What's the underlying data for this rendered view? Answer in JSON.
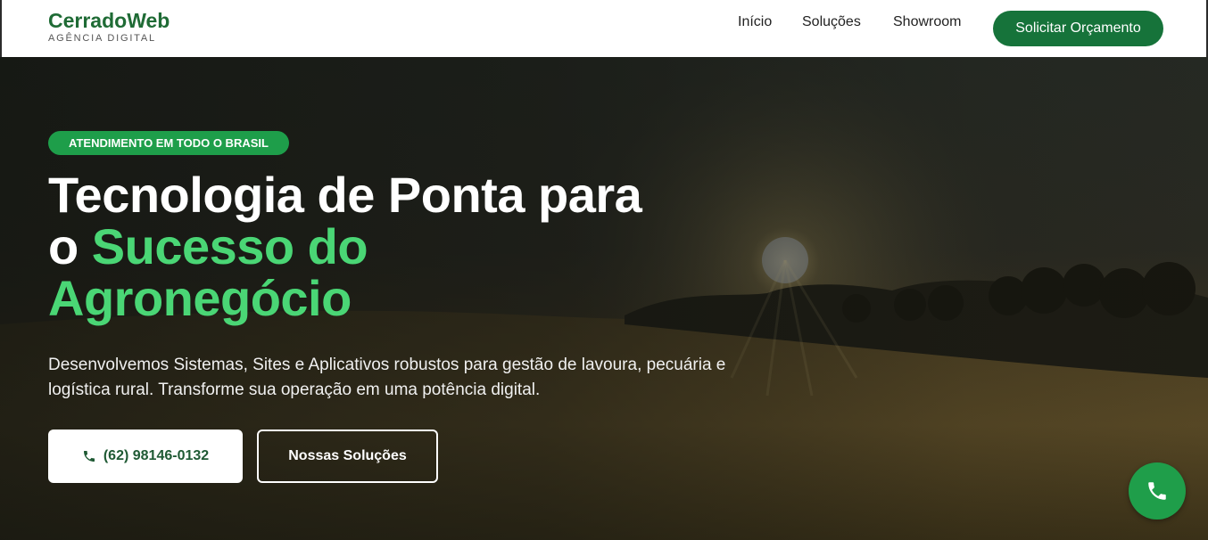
{
  "header": {
    "logo_title": "CerradoWeb",
    "logo_subtitle": "AGÊNCIA DIGITAL",
    "nav": [
      "Início",
      "Soluções",
      "Showroom"
    ],
    "cta_label": "Solicitar Orçamento"
  },
  "hero": {
    "badge": "ATENDIMENTO EM TODO O BRASIL",
    "headline_line1": "Tecnologia de Ponta para",
    "headline_line2_prefix": "o ",
    "headline_line2_accent": "Sucesso do",
    "headline_line3_accent": "Agronegócio",
    "subtext": "Desenvolvemos Sistemas, Sites e Aplicativos robustos para gestão de lavoura, pecuária e logística rural. Transforme sua operação em uma potência digital.",
    "phone_button": "(62) 98146-0132",
    "solutions_button": "Nossas Soluções"
  },
  "icons": {
    "phone": "phone-icon",
    "floating_phone": "phone-icon"
  },
  "colors": {
    "brand_green": "#16733a",
    "accent_green": "#4ad675",
    "badge_green": "#1e9e4a"
  }
}
